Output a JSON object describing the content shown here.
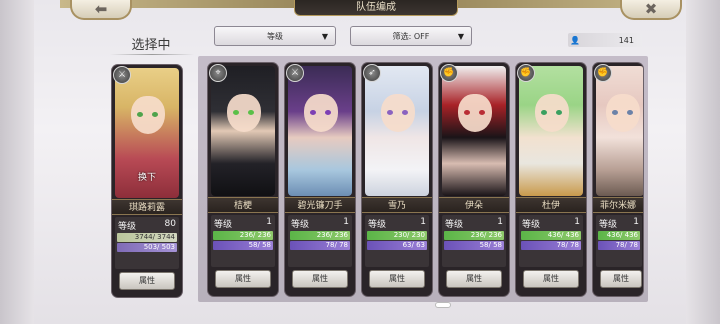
{
  "header": {
    "title": "队伍编成",
    "back_label": "⬅",
    "close_label": "✖"
  },
  "selecting_label": "选择中",
  "filters": {
    "sort_label": "等级",
    "filter_label": "筛选: OFF"
  },
  "roster_count": "141",
  "selected": {
    "name": "琪路莉露",
    "level_label": "等级",
    "level": "80",
    "hp": "3744/ 3744",
    "sp": "503/ 503",
    "swap_label": "换下",
    "attr_label": "属性",
    "eye_color": "#4fa34c"
  },
  "characters": [
    {
      "name": "桔梗",
      "level_label": "等级",
      "level": "1",
      "hp": "236/ 236",
      "sp": "58/ 58",
      "attr_label": "属性",
      "eye_color": "#5ac048"
    },
    {
      "name": "碧光镰刀手",
      "level_label": "等级",
      "level": "1",
      "hp": "236/ 236",
      "sp": "78/ 78",
      "attr_label": "属性",
      "eye_color": "#7d3fb4"
    },
    {
      "name": "雪乃",
      "level_label": "等级",
      "level": "1",
      "hp": "230/ 230",
      "sp": "63/ 63",
      "attr_label": "属性",
      "eye_color": "#8a62c0"
    },
    {
      "name": "伊朵",
      "level_label": "等级",
      "level": "1",
      "hp": "236/ 236",
      "sp": "58/ 58",
      "attr_label": "属性",
      "eye_color": "#b92d35"
    },
    {
      "name": "杜伊",
      "level_label": "等级",
      "level": "1",
      "hp": "436/ 436",
      "sp": "78/ 78",
      "attr_label": "属性",
      "eye_color": "#3aa060"
    },
    {
      "name": "菲尔米娜",
      "level_label": "等级",
      "level": "1",
      "hp": "436/ 436",
      "sp": "78/ 78",
      "attr_label": "属性",
      "eye_color": "#6b82a8"
    }
  ]
}
